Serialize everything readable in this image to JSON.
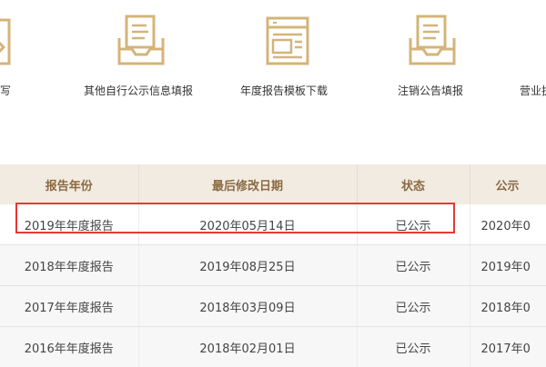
{
  "tiles": [
    {
      "label": "告填写",
      "icon": "pencil-icon"
    },
    {
      "label": "其他自行公示信息填报",
      "icon": "document-tray-icon"
    },
    {
      "label": "年度报告模板下载",
      "icon": "template-window-icon"
    },
    {
      "label": "注销公告填报",
      "icon": "document-tray-icon"
    },
    {
      "label": "营业执",
      "icon": "document-tray-icon"
    }
  ],
  "table": {
    "headers": [
      "报告年份",
      "最后修改日期",
      "状态",
      "公示"
    ],
    "rows": [
      {
        "year": "2019年年度报告",
        "date": "2020年05月14日",
        "status": "已公示",
        "pub": "2020年0"
      },
      {
        "year": "2018年年度报告",
        "date": "2019年08月25日",
        "status": "已公示",
        "pub": "2019年0"
      },
      {
        "year": "2017年年度报告",
        "date": "2018年03月09日",
        "status": "已公示",
        "pub": "2018年0"
      },
      {
        "year": "2016年年度报告",
        "date": "2018年02月01日",
        "status": "已公示",
        "pub": "2017年0"
      }
    ]
  },
  "colors": {
    "icon": "#d4b47a",
    "header_bg": "#f2ebe1",
    "header_text": "#8a6a42",
    "highlight": "#e53935"
  }
}
